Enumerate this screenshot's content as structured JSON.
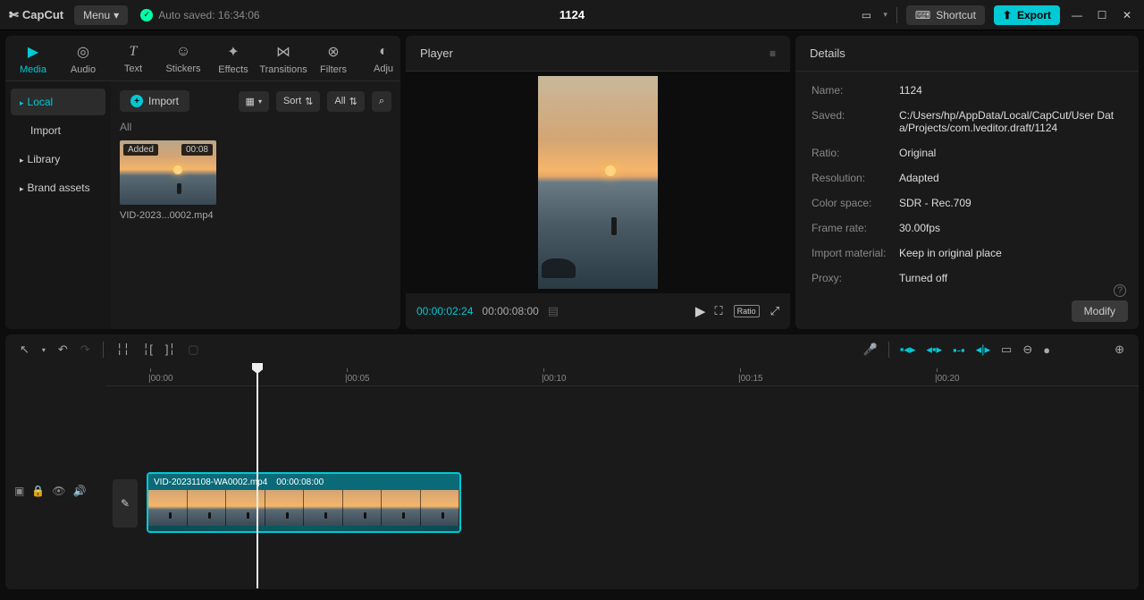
{
  "titlebar": {
    "app_name": "CapCut",
    "menu_label": "Menu",
    "auto_saved": "Auto saved: 16:34:06",
    "project_title": "1124",
    "shortcut_label": "Shortcut",
    "export_label": "Export"
  },
  "category_tabs": [
    {
      "label": "Media",
      "icon": "▶"
    },
    {
      "label": "Audio",
      "icon": "◎"
    },
    {
      "label": "Text",
      "icon": "T"
    },
    {
      "label": "Stickers",
      "icon": "☺"
    },
    {
      "label": "Effects",
      "icon": "✦"
    },
    {
      "label": "Transitions",
      "icon": "⋈"
    },
    {
      "label": "Filters",
      "icon": "⊗"
    },
    {
      "label": "Adju",
      "icon": "◐"
    }
  ],
  "sidebar": {
    "items": [
      {
        "label": "Local",
        "active": true,
        "arrow": true
      },
      {
        "label": "Import",
        "active": false,
        "arrow": false
      },
      {
        "label": "Library",
        "active": false,
        "arrow": true
      },
      {
        "label": "Brand assets",
        "active": false,
        "arrow": true
      }
    ]
  },
  "media_toolbar": {
    "import_label": "Import",
    "sort_label": "Sort",
    "all_label": "All",
    "filter_label": "All"
  },
  "media_items": [
    {
      "name": "VID-2023...0002.mp4",
      "duration": "00:08",
      "status": "Added"
    }
  ],
  "player": {
    "title": "Player",
    "current_time": "00:00:02:24",
    "total_time": "00:00:08:00",
    "ratio_label": "Ratio"
  },
  "details": {
    "title": "Details",
    "rows": [
      {
        "label": "Name:",
        "value": "1124"
      },
      {
        "label": "Saved:",
        "value": "C:/Users/hp/AppData/Local/CapCut/User Data/Projects/com.lveditor.draft/1124"
      },
      {
        "label": "Ratio:",
        "value": "Original"
      },
      {
        "label": "Resolution:",
        "value": "Adapted"
      },
      {
        "label": "Color space:",
        "value": "SDR - Rec.709"
      },
      {
        "label": "Frame rate:",
        "value": "30.00fps"
      },
      {
        "label": "Import material:",
        "value": "Keep in original place"
      },
      {
        "label": "Proxy:",
        "value": "Turned off"
      }
    ],
    "modify_label": "Modify"
  },
  "timeline": {
    "ticks": [
      {
        "label": "|00:00",
        "pos": 48
      },
      {
        "label": "|00:05",
        "pos": 268
      },
      {
        "label": "|00:10",
        "pos": 488
      },
      {
        "label": "|00:15",
        "pos": 708
      },
      {
        "label": "|00:20",
        "pos": 928
      }
    ],
    "clip": {
      "name": "VID-20231108-WA0002.mp4",
      "duration": "00:00:08:00"
    }
  }
}
